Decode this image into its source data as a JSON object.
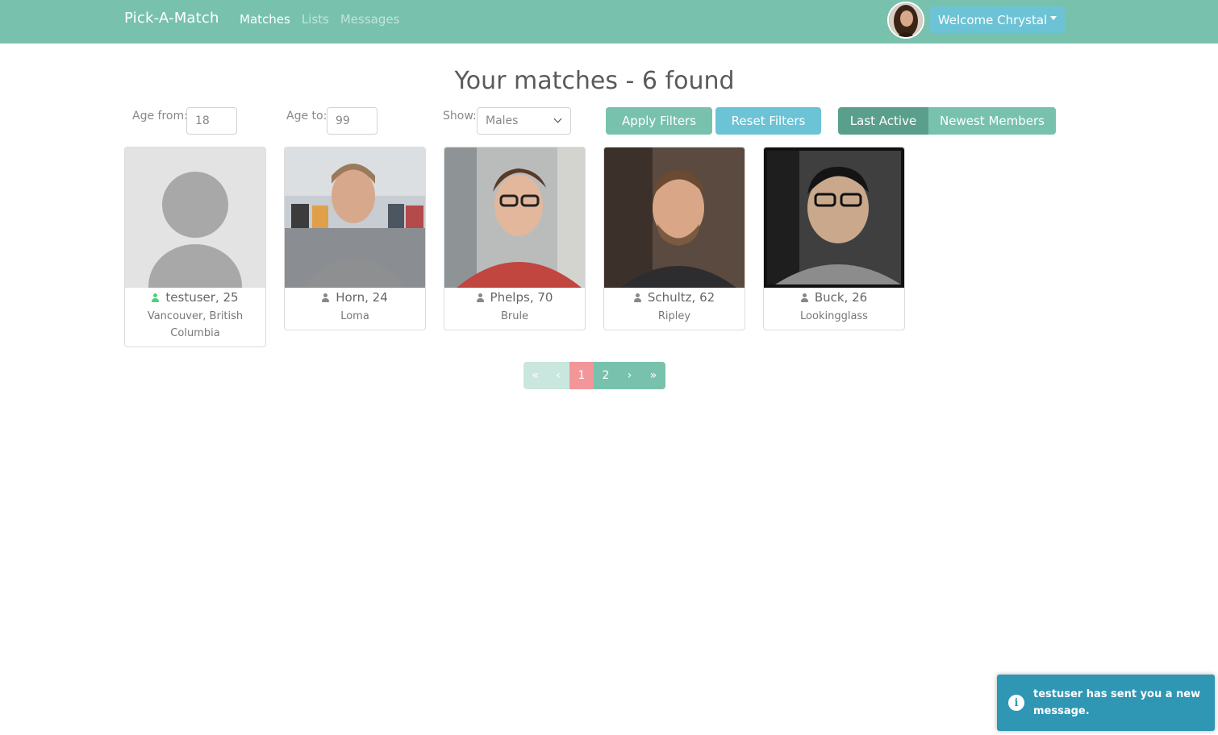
{
  "navbar": {
    "brand": "Pick-A-Match",
    "links": [
      "Matches",
      "Lists",
      "Messages"
    ],
    "active_link": "Matches",
    "welcome": "Welcome Chrystal"
  },
  "title": "Your matches - 6 found",
  "filters": {
    "age_from_label": "Age from:",
    "age_from_value": "18",
    "age_to_label": "Age to:",
    "age_to_value": "99",
    "show_label": "Show:",
    "show_value": "Males",
    "apply": "Apply Filters",
    "reset": "Reset Filters",
    "sort_last_active": "Last Active",
    "sort_newest": "Newest Members"
  },
  "members": [
    {
      "name": "testuser, 25",
      "city": "Vancouver, British Columbia",
      "online": true
    },
    {
      "name": "Horn, 24",
      "city": "Loma",
      "online": false
    },
    {
      "name": "Phelps, 70",
      "city": "Brule",
      "online": false
    },
    {
      "name": "Schultz, 62",
      "city": "Ripley",
      "online": false
    },
    {
      "name": "Buck, 26",
      "city": "Lookingglass",
      "online": false
    }
  ],
  "pagination": {
    "first": "«",
    "prev": "‹",
    "pages": [
      "1",
      "2"
    ],
    "current": "1",
    "next": "›",
    "last": "»"
  },
  "toast": {
    "message": "testuser has sent you a new message."
  },
  "colors": {
    "primary": "#78c2ad",
    "info": "#6cc3d5",
    "active_page": "#f3969a",
    "online": "#56cc7d",
    "offline": "#888888"
  }
}
